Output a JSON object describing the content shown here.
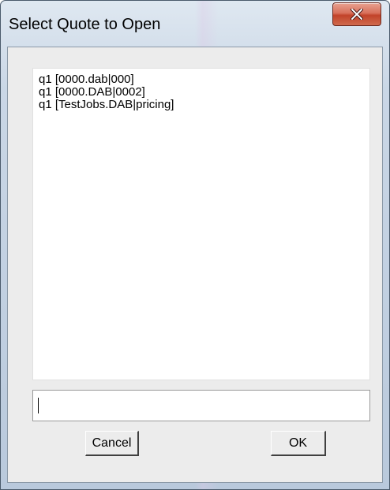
{
  "window": {
    "title": "Select Quote to Open",
    "close_icon": "close-icon"
  },
  "quote_list": {
    "items": [
      "q1 [0000.dab|000]",
      "q1 [0000.DAB|0002]",
      "q1 [TestJobs.DAB|pricing]"
    ]
  },
  "quote_input": {
    "value": ""
  },
  "buttons": {
    "cancel_label": "Cancel",
    "ok_label": "OK"
  },
  "colors": {
    "close_button": "#c2432a",
    "client_background": "#ececec"
  }
}
